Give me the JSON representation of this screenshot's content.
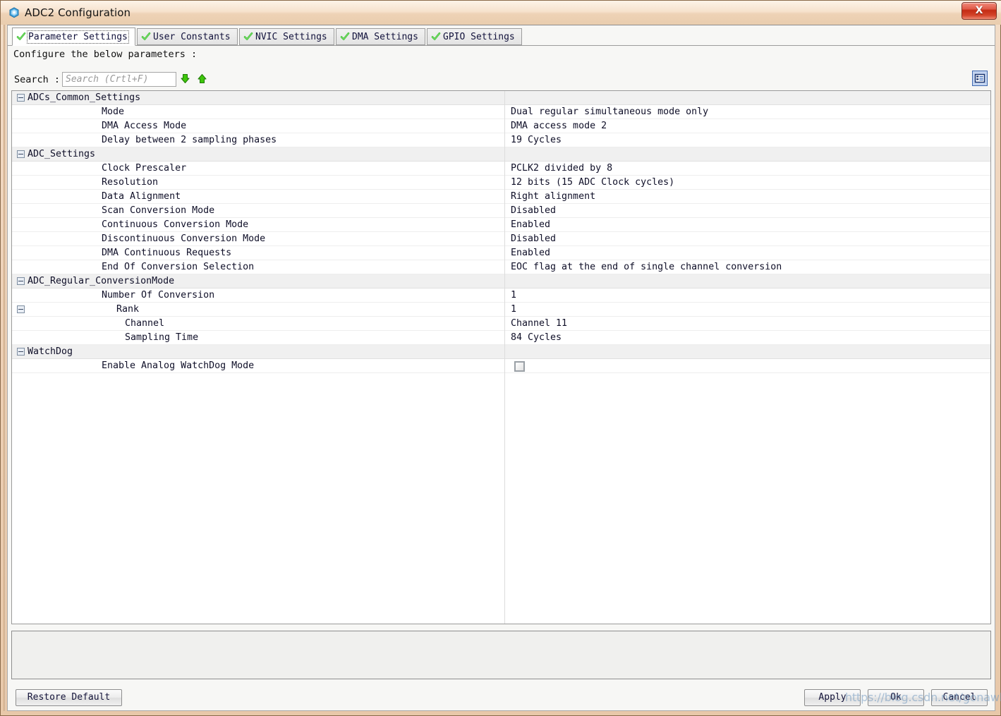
{
  "window": {
    "title": "ADC2 Configuration",
    "icon": "adc-chip-icon",
    "close_label": "X"
  },
  "tabs": [
    {
      "label": "Parameter Settings",
      "selected": true,
      "icon": "green-check-icon"
    },
    {
      "label": "User Constants",
      "selected": false,
      "icon": "green-check-icon"
    },
    {
      "label": "NVIC Settings",
      "selected": false,
      "icon": "green-check-icon"
    },
    {
      "label": "DMA Settings",
      "selected": false,
      "icon": "green-check-icon"
    },
    {
      "label": "GPIO Settings",
      "selected": false,
      "icon": "green-check-icon"
    }
  ],
  "header": {
    "configure_label": "Configure the below parameters :"
  },
  "search": {
    "label": "Search :",
    "value": "",
    "placeholder": "Search (Crtl+F)",
    "next_icon": "arrow-down-green-icon",
    "prev_icon": "arrow-up-green-icon",
    "view_toggle_icon": "list-view-icon"
  },
  "table": {
    "rows": [
      {
        "kind": "group",
        "name": "ADCs_Common_Settings",
        "value": "",
        "expander": true,
        "indent": 0
      },
      {
        "kind": "item",
        "name": "Mode",
        "value": "Dual regular simultaneous mode only",
        "expander": false,
        "indent": 1
      },
      {
        "kind": "item",
        "name": "DMA Access Mode",
        "value": "DMA access mode 2",
        "expander": false,
        "indent": 1
      },
      {
        "kind": "item",
        "name": "Delay between 2 sampling phases",
        "value": "19 Cycles",
        "expander": false,
        "indent": 1
      },
      {
        "kind": "group",
        "name": "ADC_Settings",
        "value": "",
        "expander": true,
        "indent": 0
      },
      {
        "kind": "item",
        "name": "Clock Prescaler",
        "value": "PCLK2 divided by 8",
        "expander": false,
        "indent": 1
      },
      {
        "kind": "item",
        "name": "Resolution",
        "value": "12 bits (15 ADC Clock cycles)",
        "expander": false,
        "indent": 1
      },
      {
        "kind": "item",
        "name": "Data Alignment",
        "value": "Right alignment",
        "expander": false,
        "indent": 1
      },
      {
        "kind": "item",
        "name": "Scan Conversion Mode",
        "value": "Disabled",
        "expander": false,
        "indent": 1
      },
      {
        "kind": "item",
        "name": "Continuous Conversion Mode",
        "value": "Enabled",
        "expander": false,
        "indent": 1
      },
      {
        "kind": "item",
        "name": "Discontinuous Conversion Mode",
        "value": "Disabled",
        "expander": false,
        "indent": 1
      },
      {
        "kind": "item",
        "name": "DMA Continuous Requests",
        "value": "Enabled",
        "expander": false,
        "indent": 1
      },
      {
        "kind": "item",
        "name": "End Of Conversion Selection",
        "value": "EOC flag at the end of single channel conversion",
        "expander": false,
        "indent": 1
      },
      {
        "kind": "group",
        "name": "ADC_Regular_ConversionMode",
        "value": "",
        "expander": true,
        "indent": 0
      },
      {
        "kind": "item",
        "name": "Number Of Conversion",
        "value": "1",
        "expander": false,
        "indent": 1
      },
      {
        "kind": "item",
        "name": "Rank",
        "value": "1",
        "expander": true,
        "indent": 2
      },
      {
        "kind": "item",
        "name": "Channel",
        "value": "Channel 11",
        "expander": false,
        "indent": 3
      },
      {
        "kind": "item",
        "name": "Sampling Time",
        "value": "84 Cycles",
        "expander": false,
        "indent": 3
      },
      {
        "kind": "group",
        "name": "WatchDog",
        "value": "",
        "expander": true,
        "indent": 0
      },
      {
        "kind": "checkbox",
        "name": "Enable Analog WatchDog Mode",
        "value": "",
        "checked": false,
        "expander": false,
        "indent": 1
      }
    ]
  },
  "buttons": {
    "restore_default": "Restore Default",
    "apply": "Apply",
    "ok": "Ok",
    "cancel": "Cancel"
  },
  "watermark": {
    "text": "https://blog.csdn.net/gonawk"
  }
}
